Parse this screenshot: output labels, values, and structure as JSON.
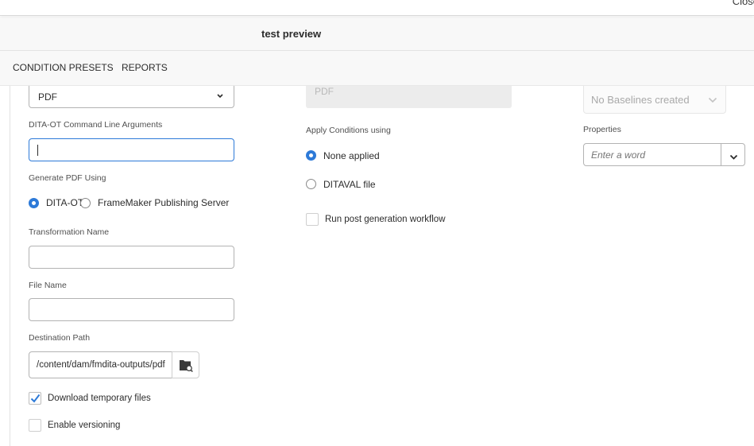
{
  "header": {
    "close_label": "Close"
  },
  "title": "test preview",
  "tabs": [
    {
      "label": "CONDITION PRESETS"
    },
    {
      "label": "REPORTS"
    }
  ],
  "left": {
    "output_type_value": "PDF",
    "cmd_args_label": "DITA-OT Command Line Arguments",
    "cmd_args_value": "",
    "generate_pdf_label": "Generate PDF Using",
    "generate_options": [
      "DITA-OT",
      "FrameMaker Publishing Server"
    ],
    "generate_selected": "DITA-OT",
    "transformation_label": "Transformation Name",
    "transformation_value": "",
    "file_name_label": "File Name",
    "file_name_value": "",
    "destination_label": "Destination Path",
    "destination_value": "/content/dam/fmdita-outputs/pdf",
    "download_temp_label": "Download temporary files",
    "download_temp_checked": true,
    "versioning_label": "Enable versioning",
    "versioning_checked": false
  },
  "middle": {
    "pdf_field_value": "PDF",
    "apply_conditions_label": "Apply Conditions using",
    "condition_options": [
      "None applied",
      "DITAVAL file"
    ],
    "condition_selected": "None applied",
    "post_workflow_label": "Run post generation workflow",
    "post_workflow_checked": false
  },
  "right": {
    "baseline_value": "No Baselines created",
    "properties_label": "Properties",
    "properties_placeholder": "Enter a word"
  },
  "colors": {
    "accent": "#2d7ad8",
    "bar_bg": "#f8f8f8"
  },
  "icons": [
    "chevron-down-icon",
    "folder-search-icon",
    "checkmark-icon"
  ]
}
